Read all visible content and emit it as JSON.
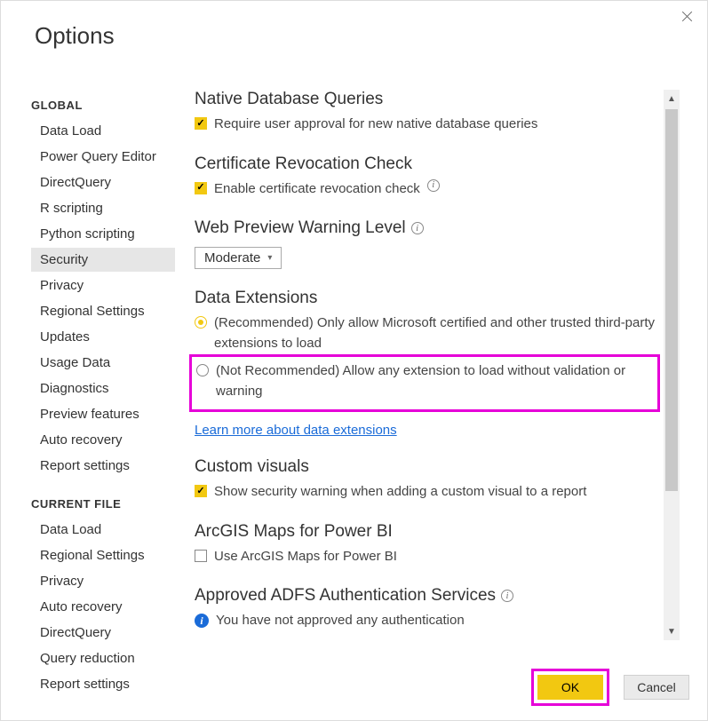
{
  "window": {
    "title": "Options"
  },
  "sidebar": {
    "sections": [
      {
        "header": "GLOBAL",
        "items": [
          "Data Load",
          "Power Query Editor",
          "DirectQuery",
          "R scripting",
          "Python scripting",
          "Security",
          "Privacy",
          "Regional Settings",
          "Updates",
          "Usage Data",
          "Diagnostics",
          "Preview features",
          "Auto recovery",
          "Report settings"
        ],
        "selected_index": 5
      },
      {
        "header": "CURRENT FILE",
        "items": [
          "Data Load",
          "Regional Settings",
          "Privacy",
          "Auto recovery",
          "DirectQuery",
          "Query reduction",
          "Report settings"
        ],
        "selected_index": -1
      }
    ]
  },
  "content": {
    "native_db": {
      "title": "Native Database Queries",
      "chk_label": "Require user approval for new native database queries"
    },
    "cert_rev": {
      "title": "Certificate Revocation Check",
      "chk_label": "Enable certificate revocation check"
    },
    "web_preview": {
      "title": "Web Preview Warning Level",
      "dropdown_value": "Moderate"
    },
    "data_ext": {
      "title": "Data Extensions",
      "radio1": "(Recommended) Only allow Microsoft certified and other trusted third-party extensions to load",
      "radio2": "(Not Recommended) Allow any extension to load without validation or warning",
      "link": "Learn more about data extensions"
    },
    "custom_visuals": {
      "title": "Custom visuals",
      "chk_label": "Show security warning when adding a custom visual to a report"
    },
    "arcgis": {
      "title": "ArcGIS Maps for Power BI",
      "chk_label": "Use ArcGIS Maps for Power BI"
    },
    "adfs": {
      "title": "Approved ADFS Authentication Services",
      "info_text": "You have not approved any authentication"
    }
  },
  "footer": {
    "ok": "OK",
    "cancel": "Cancel"
  }
}
